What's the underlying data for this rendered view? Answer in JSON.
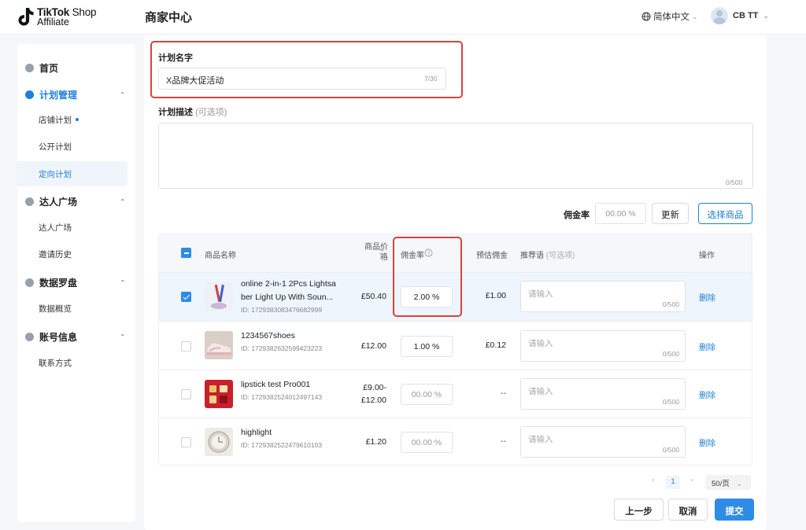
{
  "header": {
    "logo_line1_bold": "TikTok",
    "logo_line1_regular": " Shop",
    "logo_line2": "Affiliate",
    "title": "商家中心",
    "language": "简体中文",
    "user_name": "CB TT"
  },
  "sidebar": {
    "home": "首页",
    "groups": [
      {
        "label": "计划管理",
        "items": [
          "店铺计划",
          "公开计划",
          "定向计划"
        ]
      },
      {
        "label": "达人广场",
        "items": [
          "达人广场",
          "邀请历史"
        ]
      },
      {
        "label": "数据罗盘",
        "items": [
          "数据概览"
        ]
      },
      {
        "label": "账号信息",
        "items": [
          "联系方式"
        ]
      }
    ],
    "selected_item": "定向计划"
  },
  "form": {
    "name_label": "计划名字",
    "name_value": "X品牌大促活动",
    "name_counter": "7/30",
    "desc_label": "计划描述",
    "desc_optional": "(可选项)",
    "desc_counter": "0/500"
  },
  "toolbar": {
    "rate_label": "佣金率",
    "rate_placeholder": "00.00 %",
    "update_button": "更新",
    "select_button": "选择商品"
  },
  "table": {
    "headers": {
      "name": "商品名称",
      "price_line1": "商品价",
      "price_line2": "格",
      "rate": "佣金率",
      "est": "预估佣金",
      "rec": "推荐语",
      "rec_optional": "(可选项)",
      "action": "操作"
    },
    "rows": [
      {
        "name_line1": "online 2-in-1 2Pcs Lightsa",
        "name_line2": "ber Light Up With Soun...",
        "id": "ID: 1729383083476682999",
        "price_line1": "£50.40",
        "price_line2": "",
        "rate": "2.00 %",
        "commission": "£1.00",
        "rec_placeholder": "请输入",
        "rec_count": "0/500",
        "action": "删除",
        "checked": true
      },
      {
        "name_line1": "1234567shoes",
        "name_line2": "",
        "id": "ID: 1729382632599423223",
        "price_line1": "£12.00",
        "price_line2": "",
        "rate": "1.00 %",
        "commission": "£0.12",
        "rec_placeholder": "请输入",
        "rec_count": "0/500",
        "action": "删除",
        "checked": false
      },
      {
        "name_line1": "lipstick test Pro001",
        "name_line2": "",
        "id": "ID: 1729382524012497143",
        "price_line1": "£9.00-",
        "price_line2": "£12.00",
        "rate": "00.00 %",
        "commission": "--",
        "rec_placeholder": "请输入",
        "rec_count": "0/500",
        "action": "删除",
        "checked": false
      },
      {
        "name_line1": "highlight",
        "name_line2": "",
        "id": "ID: 1729382522479610103",
        "price_line1": "£1.20",
        "price_line2": "",
        "rate": "00.00 %",
        "commission": "--",
        "rec_placeholder": "请输入",
        "rec_count": "0/500",
        "action": "删除",
        "checked": false
      }
    ]
  },
  "pagination": {
    "current_page": "1",
    "page_size": "50/页"
  },
  "footer": {
    "prev_button": "上一步",
    "cancel_button": "取消",
    "submit_button": "提交"
  },
  "colors": {
    "accent": "#1e7fd6",
    "primary_button": "#2e8be6",
    "highlight_box": "#d9423e"
  }
}
